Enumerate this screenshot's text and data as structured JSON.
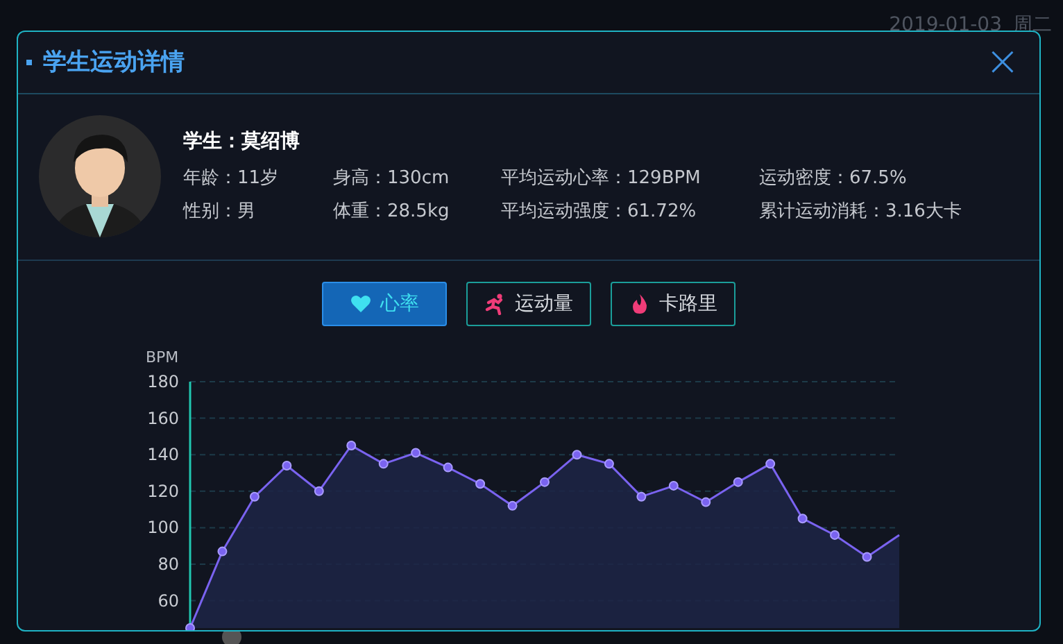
{
  "background": {
    "date": "2019-01-03",
    "weekday": "周二"
  },
  "modal": {
    "title": "学生运动详情",
    "close": "×"
  },
  "student": {
    "name_label": "学生：",
    "name": "莫绍博",
    "stats": [
      {
        "text": "年龄：11岁"
      },
      {
        "text": "身高：130cm"
      },
      {
        "text": "平均运动心率：129BPM"
      },
      {
        "text": "运动密度：67.5%"
      },
      {
        "text": "性别：男"
      },
      {
        "text": "体重：28.5kg"
      },
      {
        "text": "平均运动强度：61.72%"
      },
      {
        "text": "累计运动消耗：3.16大卡"
      }
    ]
  },
  "tabs": [
    {
      "label": "心率",
      "kind": "heart",
      "selected": true
    },
    {
      "label": "运动量",
      "kind": "runner",
      "selected": false
    },
    {
      "label": "卡路里",
      "kind": "flame",
      "selected": false
    }
  ],
  "chart_data": {
    "type": "area",
    "ylabel": "BPM",
    "grid": true,
    "ylim": [
      45,
      180
    ],
    "yticks": [
      60,
      80,
      100,
      120,
      140,
      160,
      180
    ],
    "values": [
      45,
      87,
      117,
      134,
      120,
      145,
      135,
      141,
      133,
      124,
      112,
      125,
      140,
      135,
      117,
      123,
      114,
      125,
      135,
      105,
      96,
      84,
      96
    ]
  }
}
